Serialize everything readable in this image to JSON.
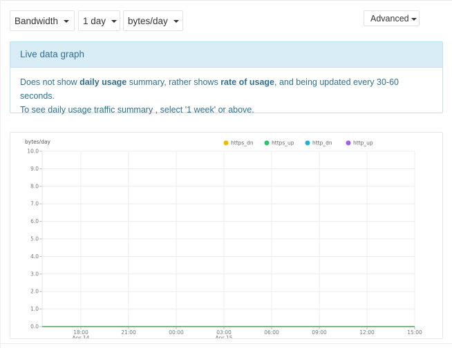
{
  "toolbar": {
    "metric": "Bandwidth",
    "range": "1 day",
    "units": "bytes/day",
    "advanced": "Advanced"
  },
  "panel": {
    "title": "Live data graph",
    "body_1": "Does not show ",
    "body_bold_1": "daily usage",
    "body_2": " summary, rather shows ",
    "body_bold_2": "rate of usage",
    "body_3": ", and being updated every 30-60 seconds.",
    "body_line_2": "To see daily usage traffic summary , select '1 week' or above."
  },
  "chart_data": {
    "type": "line",
    "ylabel": "bytes/day",
    "ylim": [
      0,
      10
    ],
    "yticks": [
      "10.0",
      "9.0",
      "8.0",
      "7.0",
      "6.0",
      "5.0",
      "4.0",
      "3.0",
      "2.0",
      "1.0",
      "0.0"
    ],
    "xticks": [
      {
        "label": "18:00",
        "sub": "Apr 14"
      },
      {
        "label": "21:00",
        "sub": ""
      },
      {
        "label": "00:00",
        "sub": ""
      },
      {
        "label": "03:00",
        "sub": "Apr 15"
      },
      {
        "label": "06:00",
        "sub": ""
      },
      {
        "label": "09:00",
        "sub": ""
      },
      {
        "label": "12:00",
        "sub": ""
      },
      {
        "label": "15:00",
        "sub": ""
      }
    ],
    "grid": true,
    "legend_position": "top",
    "series": [
      {
        "name": "https_dn",
        "color": "#f5b800",
        "values": [
          0,
          0,
          0,
          0,
          0,
          0,
          0,
          0
        ]
      },
      {
        "name": "https_up",
        "color": "#27c46b",
        "values": [
          0,
          0,
          0,
          0,
          0,
          0,
          0,
          0
        ]
      },
      {
        "name": "http_dn",
        "color": "#1fb3d1",
        "values": [
          0,
          0,
          0,
          0,
          0,
          0,
          0,
          0
        ]
      },
      {
        "name": "http_up",
        "color": "#a35cf2",
        "values": [
          0,
          0,
          0,
          0,
          0,
          0,
          0,
          0
        ]
      }
    ]
  }
}
